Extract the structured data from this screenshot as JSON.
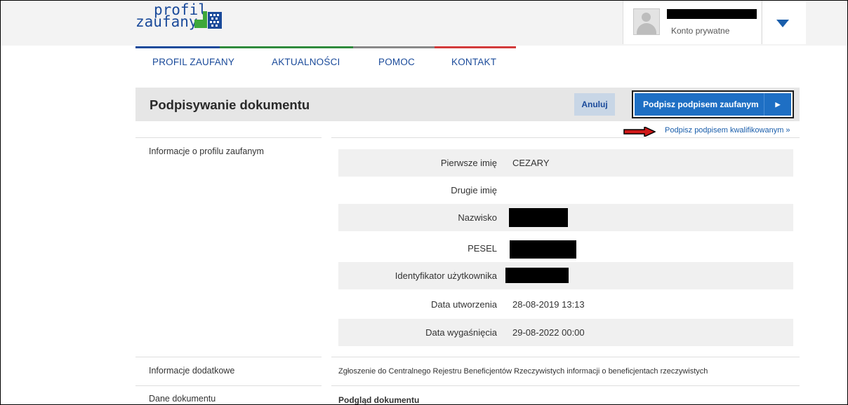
{
  "header": {
    "logo": {
      "line1": "profil",
      "line2": "zaufany"
    },
    "account": {
      "type_label": "Konto prywatne"
    }
  },
  "nav": {
    "items": [
      "PROFIL ZAUFANY",
      "AKTUALNOŚCI",
      "POMOC",
      "KONTAKT"
    ]
  },
  "page": {
    "title": "Podpisywanie dokumentu",
    "cancel_label": "Anuluj",
    "sign_trusted_label": "Podpisz podpisem zaufanym",
    "sign_qualified_link": "Podpisz podpisem kwalifikowanym »"
  },
  "sections": {
    "profile_info": "Informacje o profilu zaufanym",
    "additional_info": "Informacje dodatkowe",
    "document_data": "Dane dokumentu"
  },
  "profile_rows": [
    {
      "label": "Pierwsze imię",
      "value": "CEZARY"
    },
    {
      "label": "Drugie imię",
      "value": ""
    },
    {
      "label": "Nazwisko",
      "value": ""
    },
    {
      "label": "PESEL",
      "value": ""
    },
    {
      "label": "Identyfikator użytkownika",
      "value": ""
    },
    {
      "label": "Data utworzenia",
      "value": "28-08-2019 13:13"
    },
    {
      "label": "Data wygaśnięcia",
      "value": "29-08-2022 00:00"
    }
  ],
  "additional_info_text": "Zgłoszenie do Centralnego Rejestru Beneficjentów Rzeczywistych informacji o beneficjentach rzeczywistych",
  "document_preview_title": "Podgląd dokumentu",
  "colors": {
    "brand_blue": "#1a4a9a",
    "button_blue": "#1e6fc4",
    "logo_green": "#3ea83a",
    "stripe": [
      "#1a4a9a",
      "#2f8a3c",
      "#888888",
      "#d23a3a"
    ]
  },
  "icons": {
    "avatar": "user-avatar-icon",
    "account_toggle": "triangle-down-icon",
    "sign_arrow": "play-arrow-icon",
    "annotation": "red-arrow-icon"
  }
}
